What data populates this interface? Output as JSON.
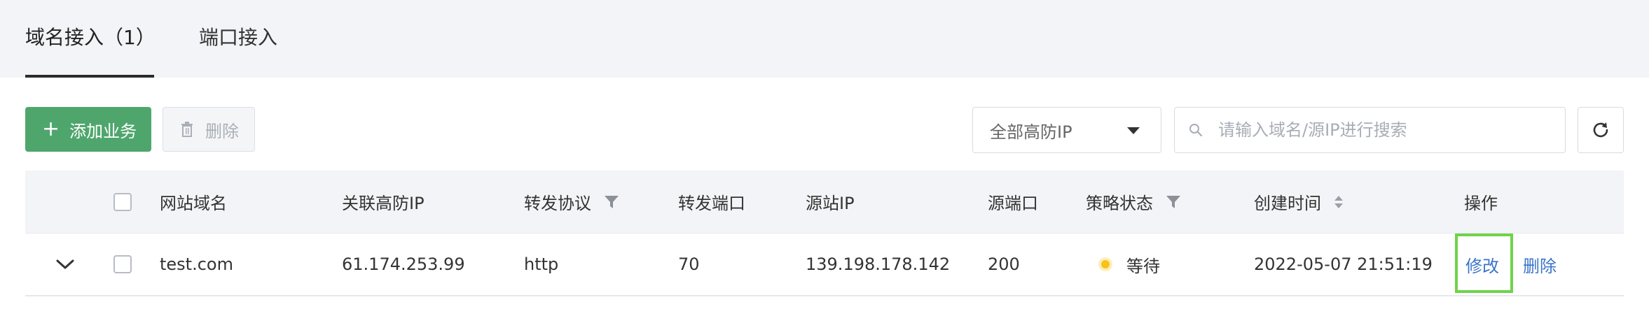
{
  "tabs": [
    {
      "label": "域名接入（1）"
    },
    {
      "label": "端口接入"
    }
  ],
  "toolbar": {
    "add_label": "添加业务",
    "delete_label": "删除",
    "select_value": "全部高防IP",
    "search_placeholder": "请输入域名/源IP进行搜索"
  },
  "table": {
    "headers": {
      "domain": "网站域名",
      "ip": "关联高防IP",
      "protocol": "转发协议",
      "port": "转发端口",
      "origin_ip": "源站IP",
      "origin_port": "源端口",
      "status": "策略状态",
      "created": "创建时间",
      "actions": "操作"
    },
    "rows": [
      {
        "domain": "test.com",
        "ip": "61.174.253.99",
        "protocol": "http",
        "port": "70",
        "origin_ip": "139.198.178.142",
        "origin_port": "200",
        "status": "等待",
        "created": "2022-05-07 21:51:19",
        "edit": "修改",
        "delete": "删除"
      }
    ]
  },
  "colors": {
    "primary_green": "#4fa66d",
    "link_blue": "#3a74c9",
    "status_pending": "#f7c21a",
    "highlight": "#6fd34a"
  }
}
